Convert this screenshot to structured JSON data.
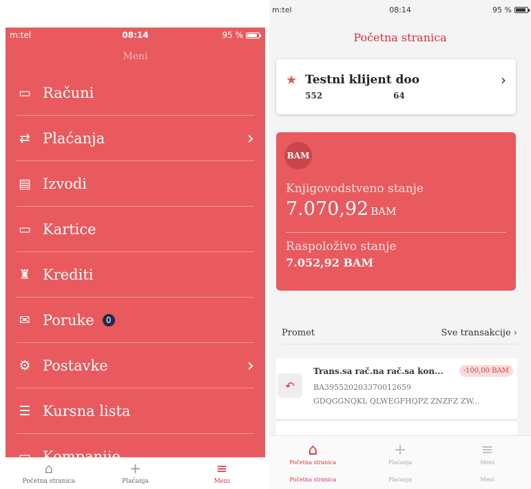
{
  "left_screen": {
    "status": {
      "carrier": "m:tel",
      "time": "08:14",
      "battery": "95 %"
    },
    "title": "Meni",
    "menu_items": [
      {
        "label": "Računi",
        "icon": "wallet-icon",
        "glyph": "▭",
        "chevron": false
      },
      {
        "label": "Plaćanja",
        "icon": "transfer-icon",
        "glyph": "⇄",
        "chevron": true
      },
      {
        "label": "Izvodi",
        "icon": "document-icon",
        "glyph": "▤",
        "chevron": false
      },
      {
        "label": "Kartice",
        "icon": "card-icon",
        "glyph": "▭",
        "chevron": false
      },
      {
        "label": "Krediti",
        "icon": "money-bag-icon",
        "glyph": "♜",
        "chevron": false
      },
      {
        "label": "Poruke",
        "icon": "envelope-icon",
        "glyph": "✉",
        "chevron": false,
        "badge": "0"
      },
      {
        "label": "Postavke",
        "icon": "gear-icon",
        "glyph": "⚙",
        "chevron": true
      },
      {
        "label": "Kursna lista",
        "icon": "list-icon",
        "glyph": "☰",
        "chevron": false
      },
      {
        "label": "Kompanije",
        "icon": "company-icon",
        "glyph": "▭",
        "chevron": false
      }
    ],
    "tabs": [
      {
        "label": "Početna stranica",
        "icon": "home-icon",
        "glyph": "⌂",
        "active": false
      },
      {
        "label": "Plaćanja",
        "icon": "plus-icon",
        "glyph": "+",
        "active": false
      },
      {
        "label": "Meni",
        "icon": "menu-icon",
        "glyph": "≡",
        "active": true
      }
    ]
  },
  "right_screen": {
    "status": {
      "carrier": "m:tel",
      "time": "08:14",
      "battery": "95 %"
    },
    "page_title": "Početna stranica",
    "client": {
      "name": "Testni klijent doo",
      "num1": "552",
      "num2": "64"
    },
    "account": {
      "currency_badge": "BAM",
      "book_balance_label": "Knjigovodstveno stanje",
      "book_balance_value": "7.070,92",
      "book_balance_currency": "BAM",
      "available_label": "Raspoloživo stanje",
      "available_value": "7.052,92 BAM"
    },
    "promet": {
      "label": "Promet",
      "all_link": "Sve transakcije"
    },
    "transaction": {
      "description": "Trans.sa rač.na rač.sa kon...",
      "amount": "-100,00 BAM",
      "account": "BA395520203370012659",
      "reference": "GDQGGNQKL QLWEGFHQPZ ZNZFZ ZW..."
    },
    "tabs": [
      {
        "label": "Početna stranica",
        "label2": "Početna stranica",
        "icon": "home-icon",
        "glyph": "⌂",
        "active": true
      },
      {
        "label": "Plaćanja",
        "label2": "Plaćanja",
        "icon": "plus-icon",
        "glyph": "+",
        "active": false
      },
      {
        "label": "Meni",
        "label2": "Meni",
        "icon": "menu-icon",
        "glyph": "≡",
        "active": false
      }
    ]
  },
  "colors": {
    "brand_red": "#e85a5e",
    "accent_red": "#d2353b",
    "badge_navy": "#1d2a4a"
  }
}
